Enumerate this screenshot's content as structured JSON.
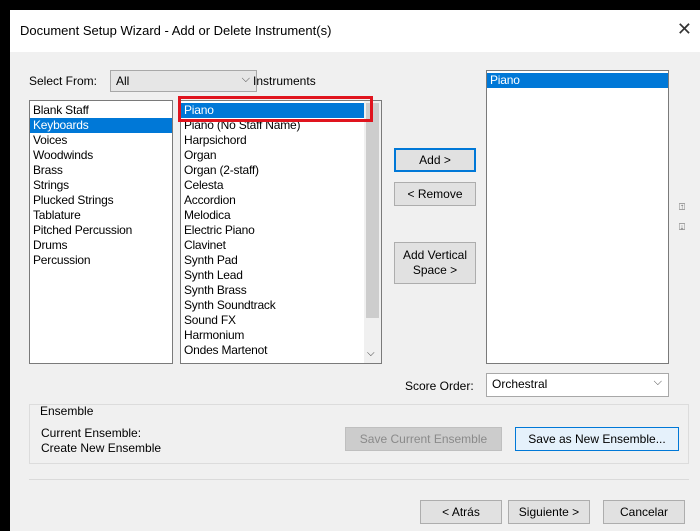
{
  "window": {
    "title": "Document Setup Wizard - Add or Delete Instrument(s)"
  },
  "select_from": {
    "label": "Select From:",
    "value": "All"
  },
  "instruments_label": "Instruments",
  "categories": [
    {
      "label": "Blank Staff",
      "selected": false
    },
    {
      "label": "Keyboards",
      "selected": true
    },
    {
      "label": "Voices",
      "selected": false
    },
    {
      "label": "Woodwinds",
      "selected": false
    },
    {
      "label": "Brass",
      "selected": false
    },
    {
      "label": "Strings",
      "selected": false
    },
    {
      "label": "Plucked Strings",
      "selected": false
    },
    {
      "label": "Tablature",
      "selected": false
    },
    {
      "label": "Pitched Percussion",
      "selected": false
    },
    {
      "label": "Drums",
      "selected": false
    },
    {
      "label": "Percussion",
      "selected": false
    }
  ],
  "instruments": [
    {
      "label": "Piano",
      "selected": true
    },
    {
      "label": "Piano (No Staff Name)",
      "selected": false
    },
    {
      "label": "Harpsichord",
      "selected": false
    },
    {
      "label": "Organ",
      "selected": false
    },
    {
      "label": "Organ (2-staff)",
      "selected": false
    },
    {
      "label": "Celesta",
      "selected": false
    },
    {
      "label": "Accordion",
      "selected": false
    },
    {
      "label": "Melodica",
      "selected": false
    },
    {
      "label": "Electric Piano",
      "selected": false
    },
    {
      "label": "Clavinet",
      "selected": false
    },
    {
      "label": "Synth Pad",
      "selected": false
    },
    {
      "label": "Synth Lead",
      "selected": false
    },
    {
      "label": "Synth Brass",
      "selected": false
    },
    {
      "label": "Synth Soundtrack",
      "selected": false
    },
    {
      "label": "Sound FX",
      "selected": false
    },
    {
      "label": "Harmonium",
      "selected": false
    },
    {
      "label": "Ondes Martenot",
      "selected": false
    }
  ],
  "buttons": {
    "add": "Add >",
    "remove": "< Remove",
    "add_vertical_line1": "Add Vertical",
    "add_vertical_line2": "Space >",
    "save_current": "Save Current Ensemble",
    "save_new": "Save as New Ensemble...",
    "back": "< Atrás",
    "next": "Siguiente >",
    "cancel": "Cancelar"
  },
  "selected_list": [
    {
      "label": "Piano",
      "selected": true
    }
  ],
  "score_order": {
    "label": "Score Order:",
    "value": "Orchestral"
  },
  "ensemble": {
    "heading": "Ensemble",
    "current_label": "Current Ensemble:",
    "current_value": "Create New Ensemble"
  },
  "icons": {
    "close": "close-icon",
    "move_up": "move-up-icon",
    "move_down": "move-down-icon"
  },
  "colors": {
    "selection": "#0078d7",
    "highlight_box": "#e0141e"
  }
}
